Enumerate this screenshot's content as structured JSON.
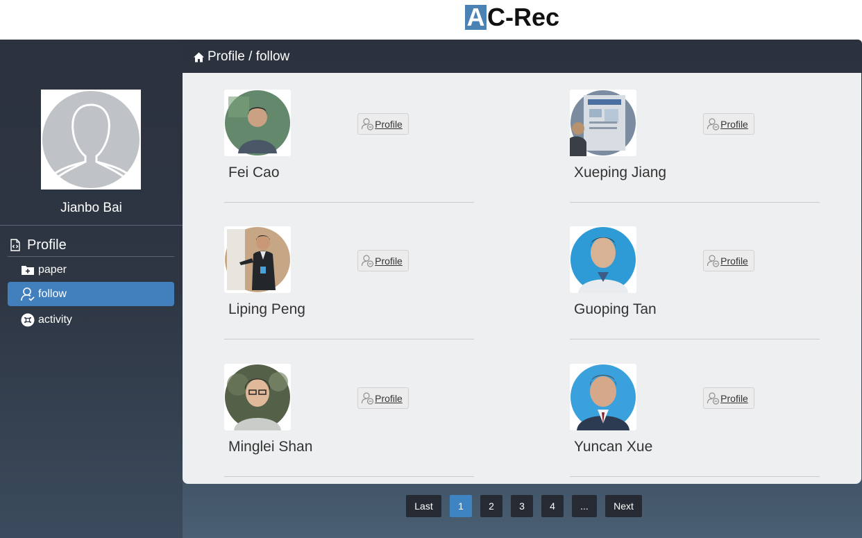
{
  "app": {
    "logo_letter": "A",
    "logo_rest": "C-Rec",
    "accent_color": "#4280bd"
  },
  "sidebar": {
    "user_name": "Jianbo Bai",
    "section_label": "Profile",
    "items": [
      {
        "label": "paper",
        "icon": "folder-plus-icon",
        "active": false
      },
      {
        "label": "follow",
        "icon": "user-check-icon",
        "active": true
      },
      {
        "label": "activity",
        "icon": "command-icon",
        "active": false
      }
    ]
  },
  "breadcrumb": {
    "text": "Profile / follow",
    "icon": "home-icon"
  },
  "follow_list": [
    {
      "name": "Fei Cao",
      "button": "Profile",
      "photo_bg": "#3f6b3a"
    },
    {
      "name": "Xueping Jiang",
      "button": "Profile",
      "photo_bg": "#7b8ca1"
    },
    {
      "name": "Liping Peng",
      "button": "Profile",
      "photo_bg": "#c7a685"
    },
    {
      "name": "Guoping Tan",
      "button": "Profile",
      "photo_bg": "#2e9bd6"
    },
    {
      "name": "Minglei Shan",
      "button": "Profile",
      "photo_bg": "#546047"
    },
    {
      "name": "Yuncan Xue",
      "button": "Profile",
      "photo_bg": "#3aa1dc"
    }
  ],
  "pagination": {
    "last": "Last",
    "pages": [
      "1",
      "2",
      "3",
      "4"
    ],
    "ellipsis": "...",
    "next": "Next",
    "current": "1"
  }
}
